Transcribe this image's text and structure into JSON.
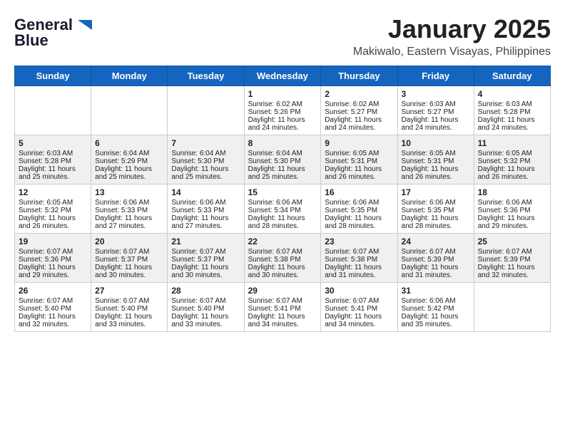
{
  "header": {
    "logo_general": "General",
    "logo_blue": "Blue",
    "month": "January 2025",
    "location": "Makiwalo, Eastern Visayas, Philippines"
  },
  "weekdays": [
    "Sunday",
    "Monday",
    "Tuesday",
    "Wednesday",
    "Thursday",
    "Friday",
    "Saturday"
  ],
  "weeks": [
    [
      {
        "day": "",
        "sunrise": "",
        "sunset": "",
        "daylight": ""
      },
      {
        "day": "",
        "sunrise": "",
        "sunset": "",
        "daylight": ""
      },
      {
        "day": "",
        "sunrise": "",
        "sunset": "",
        "daylight": ""
      },
      {
        "day": "1",
        "sunrise": "Sunrise: 6:02 AM",
        "sunset": "Sunset: 5:26 PM",
        "daylight": "Daylight: 11 hours and 24 minutes."
      },
      {
        "day": "2",
        "sunrise": "Sunrise: 6:02 AM",
        "sunset": "Sunset: 5:27 PM",
        "daylight": "Daylight: 11 hours and 24 minutes."
      },
      {
        "day": "3",
        "sunrise": "Sunrise: 6:03 AM",
        "sunset": "Sunset: 5:27 PM",
        "daylight": "Daylight: 11 hours and 24 minutes."
      },
      {
        "day": "4",
        "sunrise": "Sunrise: 6:03 AM",
        "sunset": "Sunset: 5:28 PM",
        "daylight": "Daylight: 11 hours and 24 minutes."
      }
    ],
    [
      {
        "day": "5",
        "sunrise": "Sunrise: 6:03 AM",
        "sunset": "Sunset: 5:28 PM",
        "daylight": "Daylight: 11 hours and 25 minutes."
      },
      {
        "day": "6",
        "sunrise": "Sunrise: 6:04 AM",
        "sunset": "Sunset: 5:29 PM",
        "daylight": "Daylight: 11 hours and 25 minutes."
      },
      {
        "day": "7",
        "sunrise": "Sunrise: 6:04 AM",
        "sunset": "Sunset: 5:30 PM",
        "daylight": "Daylight: 11 hours and 25 minutes."
      },
      {
        "day": "8",
        "sunrise": "Sunrise: 6:04 AM",
        "sunset": "Sunset: 5:30 PM",
        "daylight": "Daylight: 11 hours and 25 minutes."
      },
      {
        "day": "9",
        "sunrise": "Sunrise: 6:05 AM",
        "sunset": "Sunset: 5:31 PM",
        "daylight": "Daylight: 11 hours and 26 minutes."
      },
      {
        "day": "10",
        "sunrise": "Sunrise: 6:05 AM",
        "sunset": "Sunset: 5:31 PM",
        "daylight": "Daylight: 11 hours and 26 minutes."
      },
      {
        "day": "11",
        "sunrise": "Sunrise: 6:05 AM",
        "sunset": "Sunset: 5:32 PM",
        "daylight": "Daylight: 11 hours and 26 minutes."
      }
    ],
    [
      {
        "day": "12",
        "sunrise": "Sunrise: 6:05 AM",
        "sunset": "Sunset: 5:32 PM",
        "daylight": "Daylight: 11 hours and 26 minutes."
      },
      {
        "day": "13",
        "sunrise": "Sunrise: 6:06 AM",
        "sunset": "Sunset: 5:33 PM",
        "daylight": "Daylight: 11 hours and 27 minutes."
      },
      {
        "day": "14",
        "sunrise": "Sunrise: 6:06 AM",
        "sunset": "Sunset: 5:33 PM",
        "daylight": "Daylight: 11 hours and 27 minutes."
      },
      {
        "day": "15",
        "sunrise": "Sunrise: 6:06 AM",
        "sunset": "Sunset: 5:34 PM",
        "daylight": "Daylight: 11 hours and 28 minutes."
      },
      {
        "day": "16",
        "sunrise": "Sunrise: 6:06 AM",
        "sunset": "Sunset: 5:35 PM",
        "daylight": "Daylight: 11 hours and 28 minutes."
      },
      {
        "day": "17",
        "sunrise": "Sunrise: 6:06 AM",
        "sunset": "Sunset: 5:35 PM",
        "daylight": "Daylight: 11 hours and 28 minutes."
      },
      {
        "day": "18",
        "sunrise": "Sunrise: 6:06 AM",
        "sunset": "Sunset: 5:36 PM",
        "daylight": "Daylight: 11 hours and 29 minutes."
      }
    ],
    [
      {
        "day": "19",
        "sunrise": "Sunrise: 6:07 AM",
        "sunset": "Sunset: 5:36 PM",
        "daylight": "Daylight: 11 hours and 29 minutes."
      },
      {
        "day": "20",
        "sunrise": "Sunrise: 6:07 AM",
        "sunset": "Sunset: 5:37 PM",
        "daylight": "Daylight: 11 hours and 30 minutes."
      },
      {
        "day": "21",
        "sunrise": "Sunrise: 6:07 AM",
        "sunset": "Sunset: 5:37 PM",
        "daylight": "Daylight: 11 hours and 30 minutes."
      },
      {
        "day": "22",
        "sunrise": "Sunrise: 6:07 AM",
        "sunset": "Sunset: 5:38 PM",
        "daylight": "Daylight: 11 hours and 30 minutes."
      },
      {
        "day": "23",
        "sunrise": "Sunrise: 6:07 AM",
        "sunset": "Sunset: 5:38 PM",
        "daylight": "Daylight: 11 hours and 31 minutes."
      },
      {
        "day": "24",
        "sunrise": "Sunrise: 6:07 AM",
        "sunset": "Sunset: 5:39 PM",
        "daylight": "Daylight: 11 hours and 31 minutes."
      },
      {
        "day": "25",
        "sunrise": "Sunrise: 6:07 AM",
        "sunset": "Sunset: 5:39 PM",
        "daylight": "Daylight: 11 hours and 32 minutes."
      }
    ],
    [
      {
        "day": "26",
        "sunrise": "Sunrise: 6:07 AM",
        "sunset": "Sunset: 5:40 PM",
        "daylight": "Daylight: 11 hours and 32 minutes."
      },
      {
        "day": "27",
        "sunrise": "Sunrise: 6:07 AM",
        "sunset": "Sunset: 5:40 PM",
        "daylight": "Daylight: 11 hours and 33 minutes."
      },
      {
        "day": "28",
        "sunrise": "Sunrise: 6:07 AM",
        "sunset": "Sunset: 5:40 PM",
        "daylight": "Daylight: 11 hours and 33 minutes."
      },
      {
        "day": "29",
        "sunrise": "Sunrise: 6:07 AM",
        "sunset": "Sunset: 5:41 PM",
        "daylight": "Daylight: 11 hours and 34 minutes."
      },
      {
        "day": "30",
        "sunrise": "Sunrise: 6:07 AM",
        "sunset": "Sunset: 5:41 PM",
        "daylight": "Daylight: 11 hours and 34 minutes."
      },
      {
        "day": "31",
        "sunrise": "Sunrise: 6:06 AM",
        "sunset": "Sunset: 5:42 PM",
        "daylight": "Daylight: 11 hours and 35 minutes."
      },
      {
        "day": "",
        "sunrise": "",
        "sunset": "",
        "daylight": ""
      }
    ]
  ]
}
